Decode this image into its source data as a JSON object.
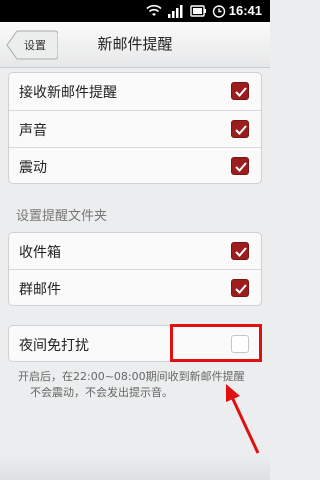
{
  "status_bar": {
    "time": "16:41",
    "icons": [
      "wifi-icon",
      "signal-icon",
      "battery-icon",
      "alarm-icon"
    ]
  },
  "header": {
    "back_label": "设置",
    "title": "新邮件提醒"
  },
  "notify_group": [
    {
      "label": "接收新邮件提醒",
      "checked": true
    },
    {
      "label": "声音",
      "checked": true
    },
    {
      "label": "震动",
      "checked": true
    }
  ],
  "folder_section": {
    "header": "设置提醒文件夹",
    "items": [
      {
        "label": "收件箱",
        "checked": true
      },
      {
        "label": "群邮件",
        "checked": true
      }
    ]
  },
  "night_mode": {
    "label": "夜间免打扰",
    "checked": false,
    "hint_line1": "开启后，在22:00~08:00期间收到新邮件提醒",
    "hint_line2": "不会震动，不会发出提示音。"
  },
  "colors": {
    "checkbox_checked": "#9b1d1d",
    "annotation": "#e01010",
    "background": "#ecedee"
  }
}
